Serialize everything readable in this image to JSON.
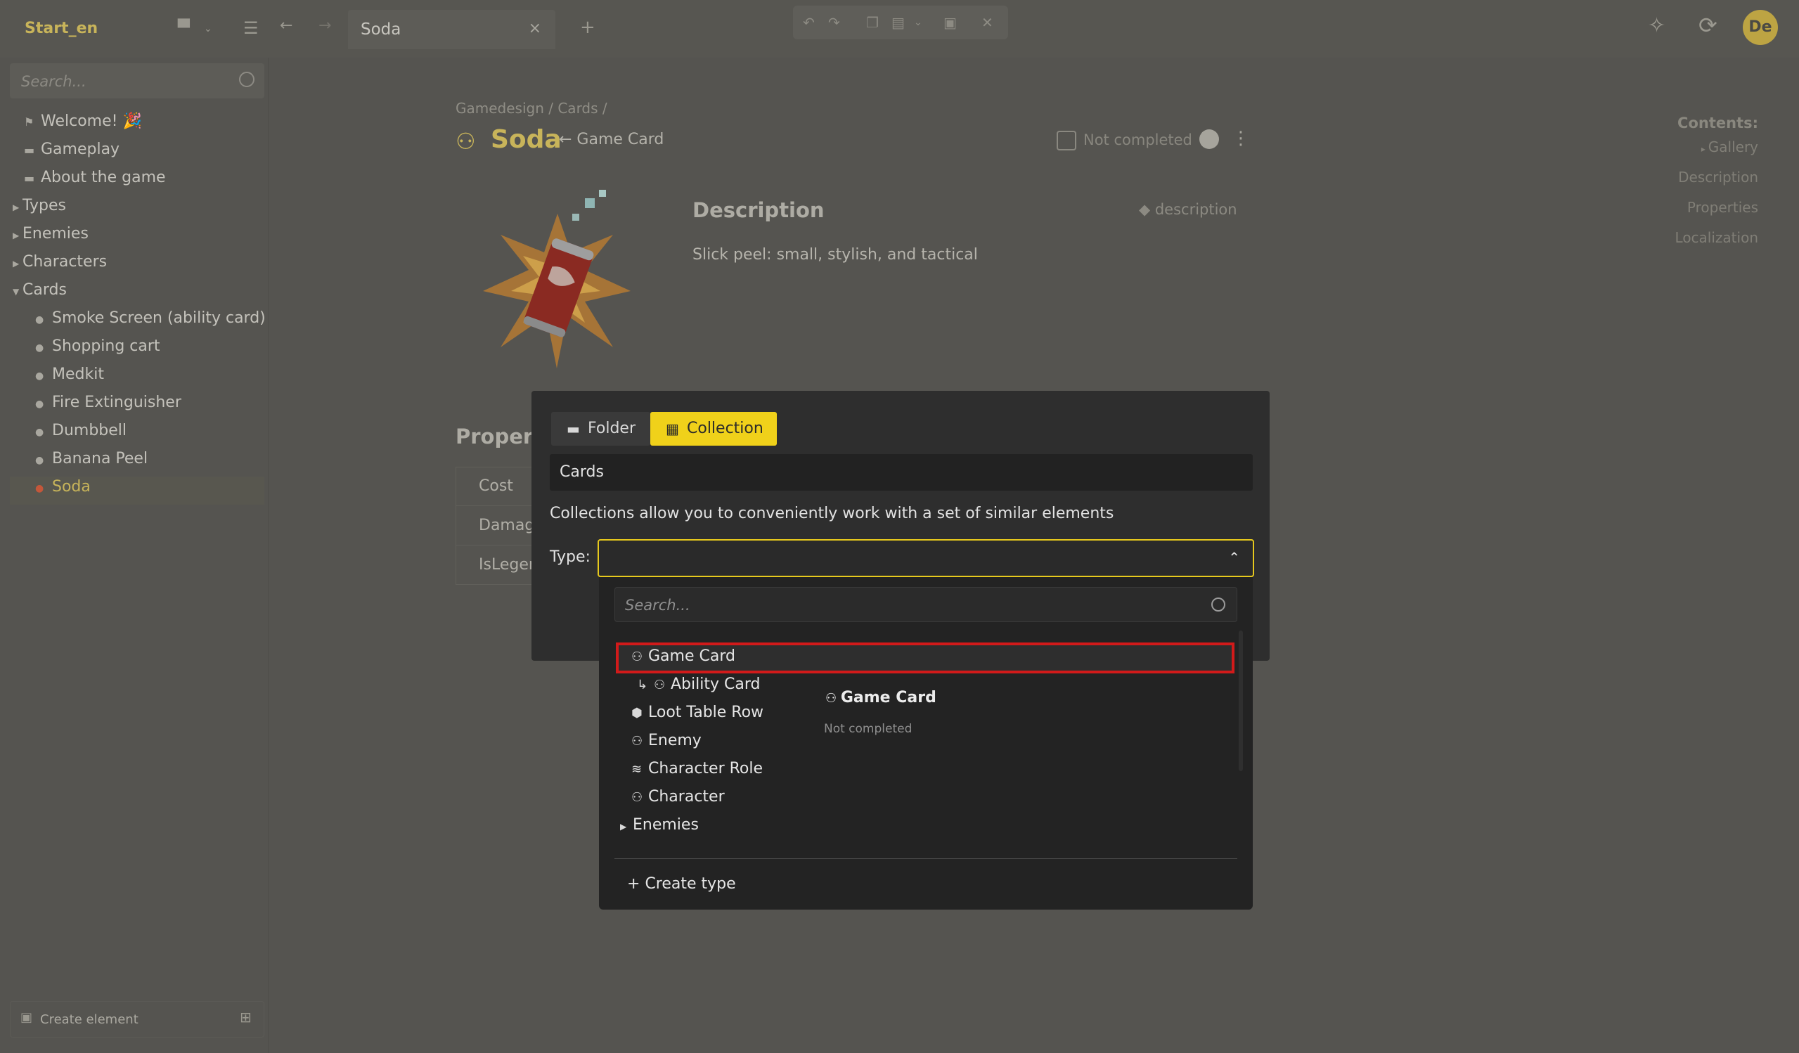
{
  "app": {
    "project_title": "Start_en",
    "tab_title": "Soda",
    "avatar_initials": "De",
    "accent_color": "#f0d11a"
  },
  "sidebar": {
    "search_placeholder": "Search...",
    "items": [
      {
        "label": "Welcome! 🎉",
        "icon": "flag-icon"
      },
      {
        "label": "Gameplay",
        "icon": "document-icon"
      },
      {
        "label": "About the game",
        "icon": "document-icon"
      },
      {
        "label": "Types",
        "icon": "caret-right-icon"
      },
      {
        "label": "Enemies",
        "icon": "caret-right-icon"
      },
      {
        "label": "Characters",
        "icon": "caret-right-icon"
      },
      {
        "label": "Cards",
        "icon": "caret-down-icon"
      },
      {
        "label": "Smoke Screen (ability card)",
        "icon": "card-thumb-icon"
      },
      {
        "label": "Shopping cart",
        "icon": "card-thumb-icon"
      },
      {
        "label": "Medkit",
        "icon": "card-thumb-icon"
      },
      {
        "label": "Fire Extinguisher",
        "icon": "card-thumb-icon"
      },
      {
        "label": "Dumbbell",
        "icon": "card-thumb-icon"
      },
      {
        "label": "Banana Peel",
        "icon": "card-thumb-icon"
      },
      {
        "label": "Soda",
        "icon": "card-thumb-icon"
      }
    ],
    "create_element": "Create element"
  },
  "document": {
    "breadcrumb": "Gamedesign / Cards /",
    "title": "Soda",
    "parent_type": "← Game Card",
    "completed_label": "Not completed",
    "description_heading": "Description",
    "description_tag": "description",
    "description_text": "Slick peel: small, stylish, and tactical",
    "properties_heading": "Propert",
    "properties": [
      "Cost",
      "Damage",
      "IsLegen"
    ],
    "contents_title": "Contents:",
    "contents": [
      "Gallery",
      "Description",
      "Properties",
      "Localization"
    ]
  },
  "modal": {
    "folder_label": "Folder",
    "collection_label": "Collection",
    "name_value": "Cards",
    "hint": "Collections allow you to conveniently work with a set of similar elements",
    "type_label": "Type:"
  },
  "dropdown": {
    "search_placeholder": "Search...",
    "items": [
      {
        "label": "Game Card",
        "icon": "type-icon",
        "highlighted": true
      },
      {
        "label": "Ability Card",
        "icon": "type-icon",
        "child": true
      },
      {
        "label": "Loot Table Row",
        "icon": "cube-icon"
      },
      {
        "label": "Enemy",
        "icon": "type-icon"
      },
      {
        "label": "Character Role",
        "icon": "layers-icon"
      },
      {
        "label": "Character",
        "icon": "type-icon"
      },
      {
        "label": "Enemies",
        "icon": "caret-right-icon"
      }
    ],
    "preview_title": "Game Card",
    "preview_status": "Not completed",
    "create_type": "Create type"
  }
}
